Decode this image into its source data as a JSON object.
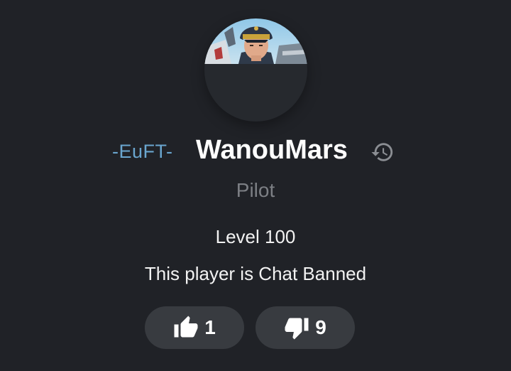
{
  "profile": {
    "clan_tag": "-EuFT-",
    "player_name": "WanouMars",
    "role": "Pilot",
    "level": "Level 100",
    "status": "This player is Chat Banned"
  },
  "votes": {
    "likes": "1",
    "dislikes": "9"
  },
  "icons": {
    "history": "history-icon",
    "like": "thumbs-up-icon",
    "dislike": "thumbs-down-icon"
  },
  "colors": {
    "background": "#202227",
    "clan_tag": "#6aa6cf",
    "role": "#7c7f84",
    "vote_button": "#383b40"
  }
}
